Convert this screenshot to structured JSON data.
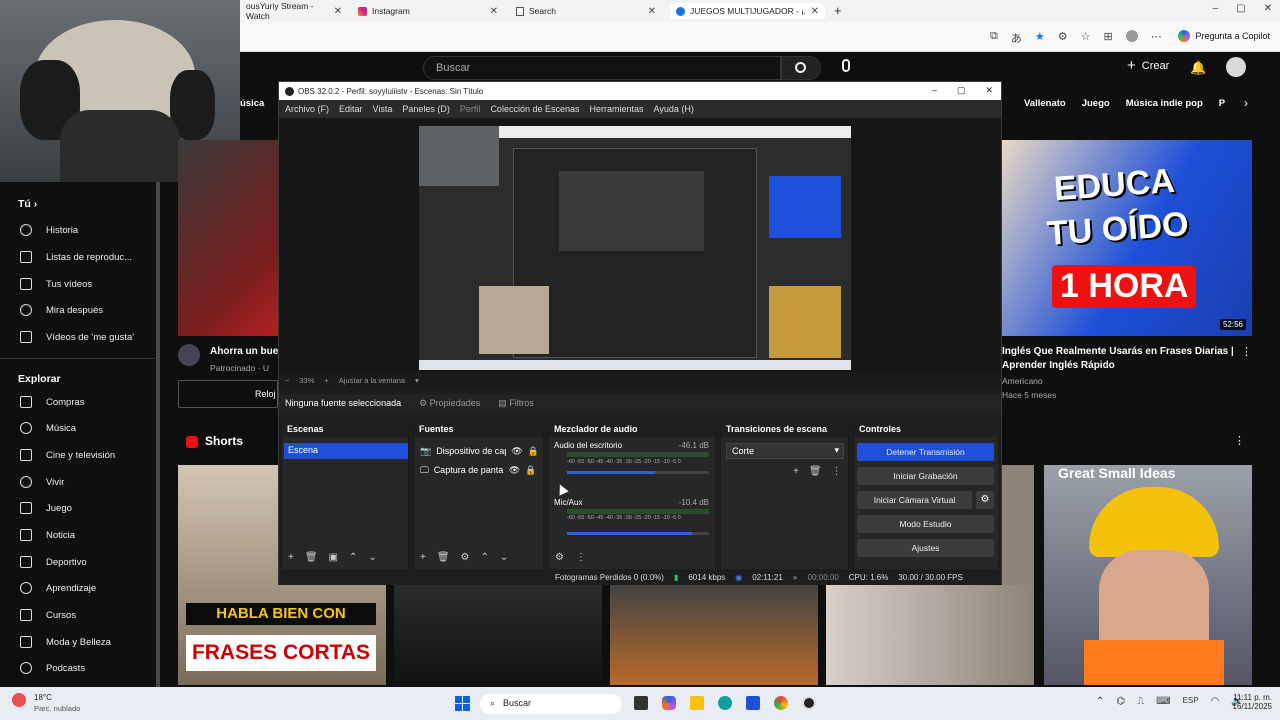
{
  "browser": {
    "tabs": [
      {
        "label": "ousYuriy Stream - Watch"
      },
      {
        "label": "Instagram"
      },
      {
        "label": "Search"
      },
      {
        "label": "JUEGOS MULTIJUGADOR - ¡A ju"
      }
    ],
    "copilot_label": "Pregunta a Copilot"
  },
  "youtube": {
    "search_placeholder": "Buscar",
    "create_label": "Crear",
    "chips": [
      "Vallenato",
      "Juego",
      "Música indie pop",
      "P"
    ],
    "left_chip": "úsica",
    "sidebar": {
      "you_label": "Tú",
      "items": [
        "Historia",
        "Listas de reproduc...",
        "Tus vídeos",
        "Mira después",
        "Vídeos de 'me gusta'"
      ],
      "explore_label": "Explorar",
      "explore_items": [
        "Compras",
        "Música",
        "Cine y televisión",
        "Vivir",
        "Juego",
        "Noticia",
        "Deportivo",
        "Aprendizaje",
        "Cursos",
        "Moda y Belleza",
        "Podcasts"
      ]
    },
    "ad": {
      "title": "Ahorra un bue",
      "sponsor": "Patrocinado · U",
      "button": "Reloj"
    },
    "video": {
      "thumb_text_1": "EDUCA",
      "thumb_text_2": "TU OÍDO",
      "thumb_text_3": "1 HORA",
      "duration": "52:56",
      "title": "Inglés Que Realmente Usarás en Frases Diarias | Aprender Inglés Rápido",
      "channel": "Americano",
      "meta": "Hace 5 meses"
    },
    "shorts_label": "Shorts",
    "short_1": {
      "line1": "HABLA BIEN CON",
      "line2": "FRASES CORTAS"
    },
    "short_5_text": "Great Small Ideas"
  },
  "obs": {
    "title": "OBS 32.0.2 - Perfil: soyyluiiistv - Escenas: Sin Título",
    "menu": [
      "Archivo (F)",
      "Editar",
      "Vista",
      "Paneles (D)",
      "Perfil",
      "Colección de Escenas",
      "Herramientas",
      "Ayuda (H)"
    ],
    "zoom": "33%",
    "fit_label": "Ajustar a la ventana",
    "no_source": "Ninguna fuente seleccionada",
    "properties_label": "Propiedades",
    "filters_label": "Filtros",
    "docks": {
      "scenes": {
        "title": "Escenas",
        "items": [
          "Escena"
        ]
      },
      "sources": {
        "title": "Fuentes",
        "items": [
          "Dispositivo de cap",
          "Captura de panta"
        ]
      },
      "mixer": {
        "title": "Mezclador de audio",
        "channels": [
          {
            "name": "Audio del escritorio",
            "db": "-46.1 dB",
            "level": 0.62
          },
          {
            "name": "Mic/Aux",
            "db": "-10.4 dB",
            "level": 0.88
          }
        ],
        "scale": "-60 -55 -50 -45 -40 -35 -30 -25 -20 -15 -10 -5 0"
      },
      "transitions": {
        "title": "Transiciones de escena",
        "selected": "Corte"
      },
      "controls": {
        "title": "Controles",
        "buttons": [
          "Detener Transmisión",
          "Iniciar Grabación",
          "Iniciar Cámara Virtual",
          "Modo Estudio",
          "Ajustes"
        ]
      }
    },
    "status": {
      "dropped": "Fotogramas Perdidos 0 (0.0%)",
      "bitrate": "6014 kbps",
      "live_time": "02:11:21",
      "rec_time": "00:00:00",
      "cpu": "CPU: 1.6%",
      "fps": "30.00 / 30.00 FPS"
    }
  },
  "taskbar": {
    "weather_temp": "18°C",
    "weather_desc": "Parc. nublado",
    "search_label": "Buscar",
    "lang": "ESP",
    "time": "11:11 p. m.",
    "date": "16/11/2025"
  },
  "colors": {
    "obs_accent": "#1f4ed8",
    "yt_bg": "#0f0f0f",
    "live_green": "#22c55e"
  }
}
